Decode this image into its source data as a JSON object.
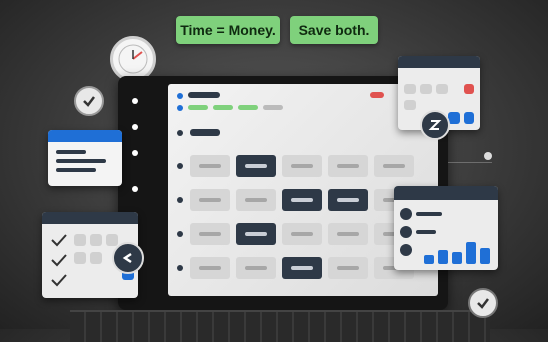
{
  "banners": {
    "left": "Time = Money.",
    "right": "Save both."
  },
  "icons": {
    "clock": "clock-icon",
    "check": "check-circle-icon",
    "sync": "sync-icon"
  },
  "colors": {
    "accent_blue": "#1f6fd6",
    "accent_green": "#7fd17c",
    "accent_red": "#e0524f",
    "dark_cell": "#2e3947"
  },
  "chart_card": {
    "bars": [
      0.35,
      0.55,
      0.45,
      0.85,
      0.6
    ]
  }
}
